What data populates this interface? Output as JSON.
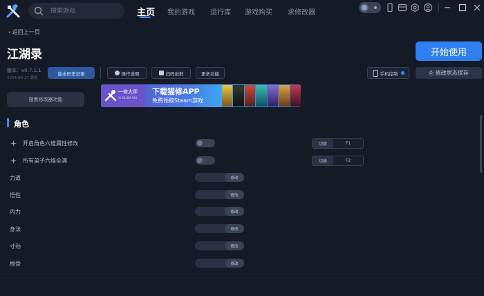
{
  "top": {
    "search_placeholder": "搜索游戏",
    "nav": [
      "主页",
      "我的游戏",
      "运行库",
      "游戏购买",
      "求修改器"
    ]
  },
  "colors": {
    "accent": "#2f7ff0",
    "background": "#151a27"
  },
  "icons": [
    "tools-logo-icon",
    "search-icon",
    "theme-toggle-icon",
    "phone-icon",
    "card-icon",
    "settings-icon",
    "user-icon",
    "minimize-icon",
    "maximize-icon",
    "close-icon"
  ],
  "header": {
    "back": "返回上一页",
    "title": "江湖录",
    "start": "开始使用",
    "version": "版本：v0.7.1.1",
    "version_date": "2024-08-27 更新",
    "history": "版本历史记录",
    "tools": [
      "操作说明",
      "扫码进群",
      "更多功能"
    ],
    "phone_control": "手机控制",
    "save_state": "修改状态保存",
    "search_mod": "搜索修改器功能"
  },
  "banner": {
    "brand": "一修大师",
    "brand_sub": "YI XIU DA SHI",
    "title": "下载猫修APP",
    "subtitle": "免费领取Steam游戏"
  },
  "section": {
    "title": "角色"
  },
  "toggle_rows": [
    {
      "label": "开启角色六维属性修改",
      "hotkey_label": "切换",
      "hotkey": "F1"
    },
    {
      "label": "所有弟子六维全满",
      "hotkey_label": "切换",
      "hotkey": "F2"
    }
  ],
  "modify_rows": [
    {
      "label": "力道",
      "button": "修改"
    },
    {
      "label": "悟性",
      "button": "修改"
    },
    {
      "label": "内力",
      "button": "修改"
    },
    {
      "label": "身法",
      "button": "修改"
    },
    {
      "label": "寸劲",
      "button": "修改"
    },
    {
      "label": "根骨",
      "button": "修改"
    }
  ]
}
